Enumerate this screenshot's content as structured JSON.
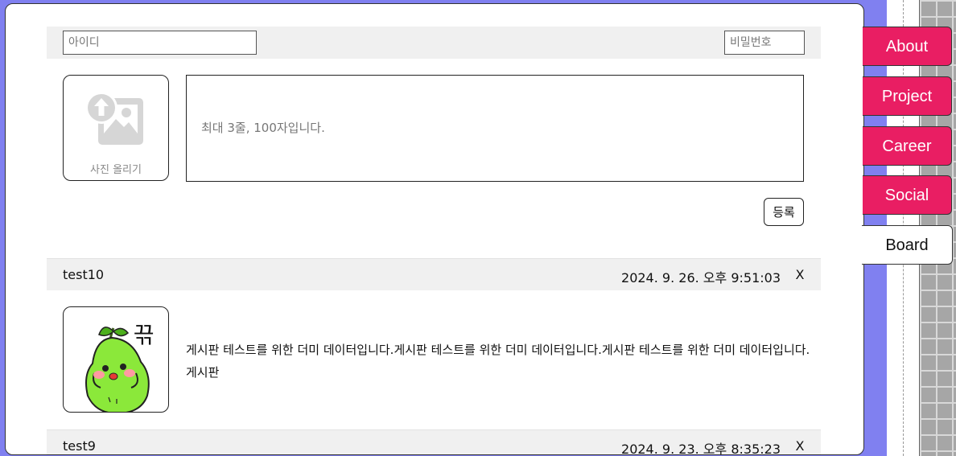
{
  "write_form": {
    "id_placeholder": "아이디",
    "password_placeholder": "비밀번호",
    "upload_label": "사진 올리기",
    "content_placeholder": "최대 3줄, 100자입니다.",
    "submit_label": "등록"
  },
  "posts": [
    {
      "author": "test10",
      "date": "2024. 9. 26. 오후 9:51:03",
      "delete_label": "X",
      "image_text": "끆",
      "content": "게시판 테스트를 위한 더미 데이터입니다.게시판 테스트를 위한 더미 데이터입니다.게시판 테스트를 위한 더미 데이터입니다.게시판"
    },
    {
      "author": "test9",
      "date": "2024. 9. 23. 오후 8:35:23",
      "delete_label": "X"
    }
  ],
  "nav": {
    "items": [
      {
        "label": "About"
      },
      {
        "label": "Project"
      },
      {
        "label": "Career"
      },
      {
        "label": "Social"
      },
      {
        "label": "Board"
      }
    ],
    "active": "Board"
  },
  "colors": {
    "background": "#8080f0",
    "tab": "#e91e63",
    "tab_active": "#ffffff"
  }
}
